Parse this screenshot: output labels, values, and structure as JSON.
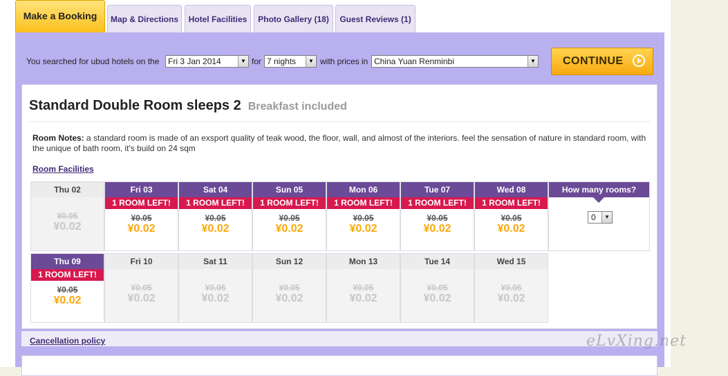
{
  "tabs": {
    "active": "Make a Booking",
    "items": [
      "Map & Directions",
      "Hotel Facilities",
      "Photo Gallery (18)",
      "Guest Reviews (1)"
    ]
  },
  "search": {
    "text_prefix": "You searched for ubud hotels on the",
    "date": "Fri 3 Jan 2014",
    "text_for": "for",
    "nights": "7 nights",
    "text_prices": "with prices in",
    "currency": "China Yuan Renminbi",
    "continue_label": "CONTINUE"
  },
  "room": {
    "title": "Standard Double Room sleeps 2",
    "subtitle": "Breakfast included",
    "notes_label": "Room Notes:",
    "notes_text": "a standard room is made of an exsport quality of teak wood, the floor, wall, and almost of the interiors. feel the sensation of nature in standard room, with the unique of bath room, it's build on 24 sqm",
    "facilities_link": "Room Facilities",
    "cancellation_link": "Cancellation policy"
  },
  "calendar": {
    "rooms_label": "How many rooms?",
    "rooms_value": "0",
    "left_label": "1 ROOM LEFT!",
    "week1": [
      {
        "day": "Thu 02",
        "orig": "¥0.05",
        "price": "¥0.02",
        "state": "past"
      },
      {
        "day": "Fri 03",
        "orig": "¥0.05",
        "price": "¥0.02",
        "state": "avail"
      },
      {
        "day": "Sat 04",
        "orig": "¥0.05",
        "price": "¥0.02",
        "state": "avail"
      },
      {
        "day": "Sun 05",
        "orig": "¥0.05",
        "price": "¥0.02",
        "state": "avail"
      },
      {
        "day": "Mon 06",
        "orig": "¥0.05",
        "price": "¥0.02",
        "state": "avail"
      },
      {
        "day": "Tue 07",
        "orig": "¥0.05",
        "price": "¥0.02",
        "state": "avail"
      },
      {
        "day": "Wed 08",
        "orig": "¥0.05",
        "price": "¥0.02",
        "state": "avail"
      }
    ],
    "week2": [
      {
        "day": "Thu 09",
        "orig": "¥0.05",
        "price": "¥0.02",
        "state": "avail"
      },
      {
        "day": "Fri 10",
        "orig": "¥0.05",
        "price": "¥0.02",
        "state": "gray"
      },
      {
        "day": "Sat 11",
        "orig": "¥0.05",
        "price": "¥0.02",
        "state": "gray"
      },
      {
        "day": "Sun 12",
        "orig": "¥0.05",
        "price": "¥0.02",
        "state": "gray"
      },
      {
        "day": "Mon 13",
        "orig": "¥0.05",
        "price": "¥0.02",
        "state": "gray"
      },
      {
        "day": "Tue 14",
        "orig": "¥0.05",
        "price": "¥0.02",
        "state": "gray"
      },
      {
        "day": "Wed 15",
        "orig": "¥0.05",
        "price": "¥0.02",
        "state": "gray"
      }
    ]
  },
  "watermark": "eLvXing.net"
}
